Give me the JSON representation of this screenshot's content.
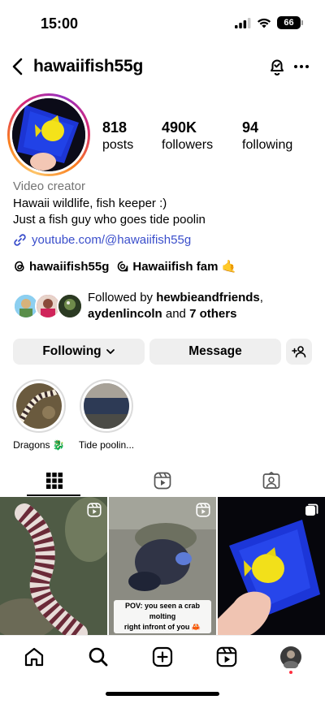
{
  "status_bar": {
    "time": "15:00",
    "battery": "66"
  },
  "header": {
    "username": "hawaiifish55g"
  },
  "stats": [
    {
      "value": "818",
      "label": "posts"
    },
    {
      "value": "490K",
      "label": "followers"
    },
    {
      "value": "94",
      "label": "following"
    }
  ],
  "bio": {
    "category": "Video creator",
    "line1": "Hawaii wildlife, fish keeper :)",
    "line2": "Just a fish guy who goes tide poolin",
    "link": "youtube.com/@hawaiifish55g"
  },
  "threads": {
    "handle": "hawaiifish55g",
    "channel": "Hawaiifish fam 🤙"
  },
  "followed_by": {
    "prefix": "Followed by ",
    "user1": "hewbieandfriends",
    "sep": ",",
    "user2": "aydenlincoln",
    "and_text": " and ",
    "others": "7 others"
  },
  "buttons": {
    "following": "Following",
    "message": "Message"
  },
  "highlights": [
    {
      "label": "Dragons 🐉"
    },
    {
      "label": "Tide poolin..."
    }
  ],
  "posts": [
    {
      "type": "reel"
    },
    {
      "type": "reel",
      "caption_line1": "POV: you seen a crab molting",
      "caption_line2": "right infront of you 🦀"
    },
    {
      "type": "carousel"
    }
  ],
  "colors": {
    "link": "#3a4ecb",
    "button_bg": "#efefef",
    "notification_dot": "#ff3040"
  }
}
